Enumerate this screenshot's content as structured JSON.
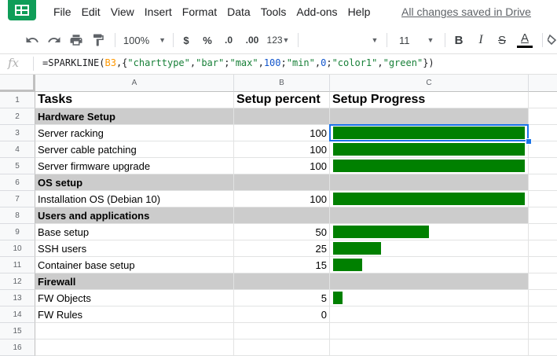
{
  "app": {
    "menu": [
      "File",
      "Edit",
      "View",
      "Insert",
      "Format",
      "Data",
      "Tools",
      "Add-ons",
      "Help"
    ],
    "save_status": "All changes saved in Drive"
  },
  "toolbar": {
    "zoom": "100%",
    "currency": "$",
    "percent": "%",
    "decimal_decrease": ".0",
    "decimal_increase": ".00",
    "more_formats": "123",
    "font_size": "11",
    "bold": "B",
    "italic": "I",
    "strikethrough": "S",
    "text_color": "A"
  },
  "formula_bar": {
    "fx_label": "fx",
    "parts": [
      {
        "t": "=SPARKLINE(",
        "c": "plain"
      },
      {
        "t": "B3",
        "c": "ref"
      },
      {
        "t": ",{",
        "c": "plain"
      },
      {
        "t": "\"charttype\"",
        "c": "str"
      },
      {
        "t": ",",
        "c": "plain"
      },
      {
        "t": "\"bar\"",
        "c": "str"
      },
      {
        "t": ";",
        "c": "plain"
      },
      {
        "t": "\"max\"",
        "c": "str"
      },
      {
        "t": ",",
        "c": "plain"
      },
      {
        "t": "100",
        "c": "num"
      },
      {
        "t": ";",
        "c": "plain"
      },
      {
        "t": "\"min\"",
        "c": "str"
      },
      {
        "t": ",",
        "c": "plain"
      },
      {
        "t": "0",
        "c": "num"
      },
      {
        "t": ";",
        "c": "plain"
      },
      {
        "t": "\"color1\"",
        "c": "str"
      },
      {
        "t": ",",
        "c": "plain"
      },
      {
        "t": "\"green\"",
        "c": "str"
      },
      {
        "t": "})",
        "c": "plain"
      }
    ]
  },
  "sheet": {
    "columns": [
      "A",
      "B",
      "C"
    ],
    "selected_row": 3,
    "sparkline": {
      "max": 100,
      "min": 0,
      "color": "#008000"
    },
    "rows": [
      {
        "n": "1",
        "type": "header",
        "a": "Tasks",
        "b": "Setup percent",
        "c": "Setup Progress"
      },
      {
        "n": "2",
        "type": "section",
        "a": "Hardware Setup"
      },
      {
        "n": "3",
        "type": "task",
        "a": "Server racking",
        "b": "100",
        "v": 100
      },
      {
        "n": "4",
        "type": "task",
        "a": "Server cable patching",
        "b": "100",
        "v": 100
      },
      {
        "n": "5",
        "type": "task",
        "a": "Server firmware upgrade",
        "b": "100",
        "v": 100
      },
      {
        "n": "6",
        "type": "section",
        "a": "OS setup"
      },
      {
        "n": "7",
        "type": "task",
        "a": "Installation OS (Debian 10)",
        "b": "100",
        "v": 100
      },
      {
        "n": "8",
        "type": "section",
        "a": "Users and applications"
      },
      {
        "n": "9",
        "type": "task",
        "a": "Base setup",
        "b": "50",
        "v": 50
      },
      {
        "n": "10",
        "type": "task",
        "a": "SSH users",
        "b": "25",
        "v": 25
      },
      {
        "n": "11",
        "type": "task",
        "a": "Container base setup",
        "b": "15",
        "v": 15
      },
      {
        "n": "12",
        "type": "section",
        "a": "Firewall"
      },
      {
        "n": "13",
        "type": "task",
        "a": "FW Objects",
        "b": "5",
        "v": 5
      },
      {
        "n": "14",
        "type": "task",
        "a": "FW Rules",
        "b": "0",
        "v": 0
      },
      {
        "n": "15",
        "type": "empty"
      },
      {
        "n": "16",
        "type": "empty"
      }
    ]
  },
  "colors": {
    "accent": "#1a73e8",
    "brand": "#0f9d58",
    "section_fill": "#cccccc",
    "bar": "#008000"
  }
}
